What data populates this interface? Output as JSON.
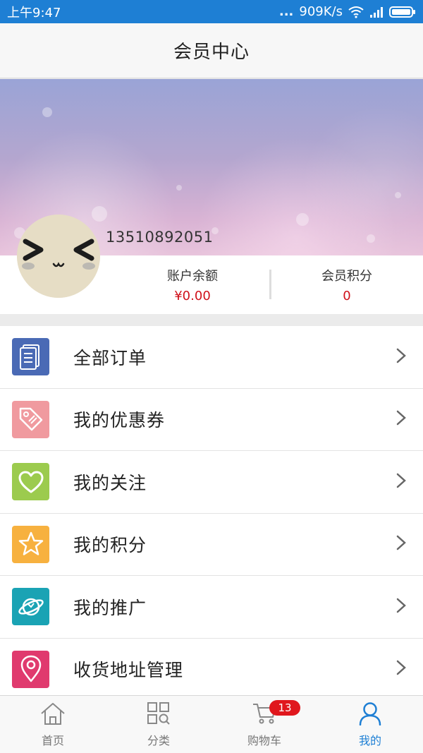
{
  "status_bar": {
    "time": "上午9:47",
    "dots": "...",
    "network_speed": "909K/s"
  },
  "header": {
    "title": "会员中心"
  },
  "profile": {
    "phone": "13510892051",
    "balance_label": "账户余额",
    "balance_value": "¥0.00",
    "points_label": "会员积分",
    "points_value": "0"
  },
  "menu": {
    "items": [
      {
        "label": "全部订单",
        "icon": "order-list-icon",
        "color": "#4a6ab5"
      },
      {
        "label": "我的优惠券",
        "icon": "coupon-tag-icon",
        "color": "#f09a9f"
      },
      {
        "label": "我的关注",
        "icon": "heart-icon",
        "color": "#9ccb4e"
      },
      {
        "label": "我的积分",
        "icon": "star-icon",
        "color": "#f7b13f"
      },
      {
        "label": "我的推广",
        "icon": "planet-icon",
        "color": "#1aa3b4"
      },
      {
        "label": "收货地址管理",
        "icon": "location-pin-icon",
        "color": "#e03a6e"
      }
    ]
  },
  "bottom_nav": {
    "items": [
      {
        "label": "首页",
        "icon": "home-icon"
      },
      {
        "label": "分类",
        "icon": "category-grid-icon"
      },
      {
        "label": "购物车",
        "icon": "cart-icon",
        "badge": "13"
      },
      {
        "label": "我的",
        "icon": "user-icon",
        "active": true
      }
    ]
  },
  "colors": {
    "accent": "#1e7fd4",
    "price_red": "#d0121b",
    "badge_red": "#e0171d"
  }
}
